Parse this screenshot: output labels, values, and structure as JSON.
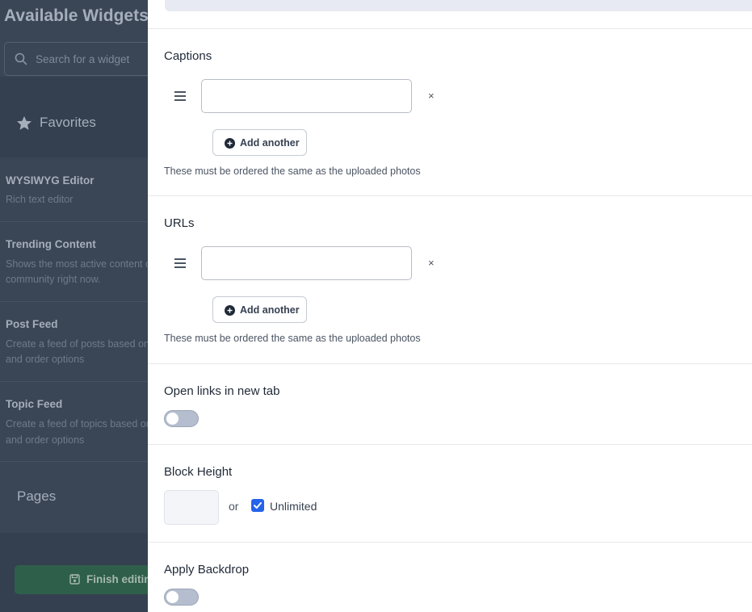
{
  "sidebar": {
    "title": "Available Widgets",
    "search_placeholder": "Search for a widget",
    "favorites_label": "Favorites",
    "widgets": [
      {
        "name": "WYSIWYG Editor",
        "desc_lines": [
          "Rich text editor"
        ]
      },
      {
        "name": "Trending Content",
        "desc_lines": [
          "Shows the most active content on the",
          "community right now."
        ]
      },
      {
        "name": "Post Feed",
        "desc_lines": [
          "Create a feed of posts based on filter",
          "and order options"
        ]
      },
      {
        "name": "Topic Feed",
        "desc_lines": [
          "Create a feed of topics based on filter",
          "and order options"
        ]
      }
    ],
    "pages_label": "Pages",
    "finish_label": "Finish editing"
  },
  "captions": {
    "label": "Captions",
    "value": "",
    "remove_symbol": "×",
    "add_label": "Add another",
    "help": "These must be ordered the same as the uploaded photos"
  },
  "urls": {
    "label": "URLs",
    "value": "",
    "remove_symbol": "×",
    "add_label": "Add another",
    "help": "These must be ordered the same as the uploaded photos"
  },
  "open_links": {
    "label": "Open links in new tab",
    "enabled": false
  },
  "block_height": {
    "label": "Block Height",
    "value": "",
    "or_text": "or",
    "unlimited_label": "Unlimited",
    "unlimited_checked": true
  },
  "apply_backdrop": {
    "label": "Apply Backdrop",
    "enabled": false
  },
  "colors": {
    "sidebar_bg": "#3a4556",
    "accent_blue": "#2563eb",
    "toggle_off": "#b5bece"
  },
  "icons": [
    "search-icon",
    "star-icon",
    "drag-handle-icon",
    "close-icon",
    "plus-circle-icon",
    "save-icon",
    "checkmark-icon"
  ]
}
